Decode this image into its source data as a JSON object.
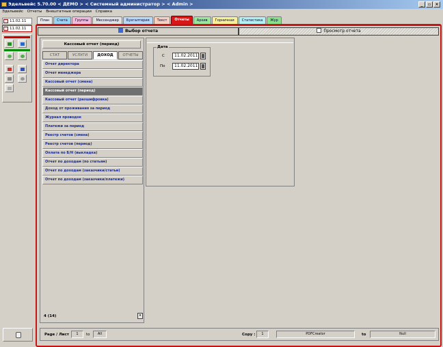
{
  "window": {
    "title": "Эдельвейс 5.70.00 < ДЕМО > < Системный администратор > < Admin >"
  },
  "menu": [
    "Эдельвейс",
    "Отчеты",
    "Внештатные операции",
    "Справка"
  ],
  "left_toolbar": {
    "date_primary": "11.02.11",
    "date_secondary": "11.02.11"
  },
  "module_tabs": [
    {
      "label": "План",
      "color": "#e8e8e8"
    },
    {
      "label": "Счета",
      "color": "#9ad4f4"
    },
    {
      "label": "Группы",
      "color": "#f4b8d8"
    },
    {
      "label": "Мессенджер",
      "color": "#e0e0e0"
    },
    {
      "label": "Бухгалтерия",
      "color": "#b8d8f8"
    },
    {
      "label": "Текст",
      "color": "#f8d0c0"
    },
    {
      "label": "Отчеты",
      "color": "#d81818",
      "active": true
    },
    {
      "label": "Архив",
      "color": "#9ae69a"
    },
    {
      "label": "Горничная",
      "color": "#f8f098"
    },
    {
      "label": "Статистика",
      "color": "#b0f0f0"
    },
    {
      "label": "Жур",
      "color": "#88e088"
    }
  ],
  "report_tabs": {
    "select": "Выбор отчета",
    "preview": "Просмотр отчета"
  },
  "report_panel": {
    "title": "Кассовый отчет (период)",
    "categories": [
      {
        "label": "СТАТ",
        "active": false
      },
      {
        "label": "УСЛУГИ",
        "active": false
      },
      {
        "label": "ДОХОД",
        "active": true
      },
      {
        "label": "ОТЧЕТЫ",
        "active": false
      }
    ],
    "items": [
      "Отчет директора",
      "Отчет менеджера",
      "Кассовый отчет (смена)",
      "Кассовый отчет (период)",
      "Кассовый отчет (разшифровка)",
      "Доход от проживания за период",
      "Журнал проводок",
      "Платежи за период",
      "Реестр счетов (смена)",
      "Реестр счетов (период)",
      "Оплата по Б/Н (выкладка)",
      "Отчет по доходам (по статьям)",
      "Отчет по доходам (заказчики/статьи)",
      "Отчет по доходам (заказчики/платежи)"
    ],
    "selected_index": 3,
    "counter": "4 (14)"
  },
  "params": {
    "group_label": "Дата",
    "from_label": "С",
    "to_label": "По",
    "from_value": "11.02.2011",
    "to_value": "11.02.2011"
  },
  "bottom_bar": {
    "page_label": "Page / Лист",
    "page_from": "1",
    "to_label": "to",
    "page_to": "All",
    "copy_label": "Copy :",
    "copy_value": "1",
    "printer": "PDFCreator",
    "printer_to_label": "to",
    "output": "Null"
  }
}
